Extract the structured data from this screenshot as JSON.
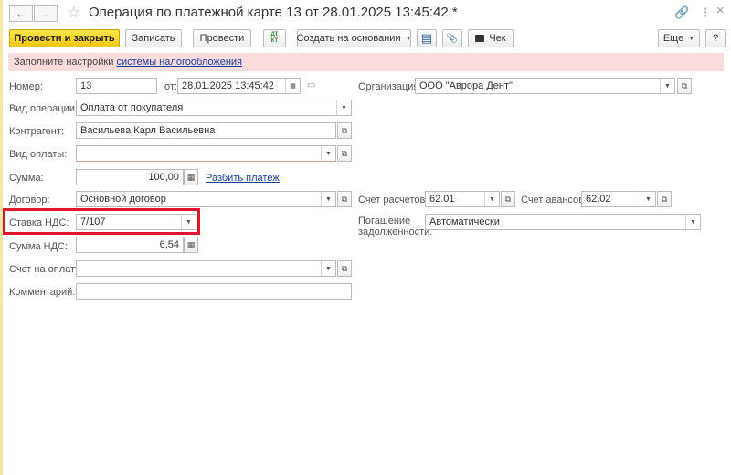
{
  "window": {
    "title": "Операция по платежной карте 13 от 28.01.2025 13:45:42 *",
    "back_icon": "←",
    "forward_icon": "→",
    "star_icon": "☆",
    "link_icon": "🔗",
    "more_icon": "⋮",
    "close_icon": "×"
  },
  "toolbar": {
    "post_and_close": "Провести и закрыть",
    "save": "Записать",
    "post": "Провести",
    "dt_kt_top": "ДТ",
    "dt_kt_bottom": "КТ",
    "create_based_on": "Создать на основании",
    "print_icon": "▤",
    "attach_icon": "📎",
    "receipt": "Чек",
    "more": "Еще",
    "help": "?"
  },
  "notice": {
    "prefix": "Заполните настройки ",
    "link": "системы налогообложения"
  },
  "form": {
    "number": {
      "label": "Номер:",
      "value": "13"
    },
    "date": {
      "label": "от:",
      "value": "28.01.2025 13:45:42"
    },
    "organization": {
      "label": "Организация:",
      "value": "ООО \"Аврора Дент\""
    },
    "operation_type": {
      "label": "Вид операции:",
      "value": "Оплата от покупателя"
    },
    "counterparty": {
      "label": "Контрагент:",
      "value": "Васильева Карл Васильевна"
    },
    "payment_type": {
      "label": "Вид оплаты:",
      "value": ""
    },
    "amount": {
      "label": "Сумма:",
      "value": "100,00",
      "split_link": "Разбить платеж"
    },
    "contract": {
      "label": "Договор:",
      "value": "Основной договор"
    },
    "settlement_account": {
      "label": "Счет расчетов:",
      "value": "62.01"
    },
    "advance_account": {
      "label": "Счет авансов:",
      "value": "62.02"
    },
    "vat_rate": {
      "label": "Ставка НДС:",
      "value": "7/107"
    },
    "debt_repayment": {
      "label_line1": "Погашение",
      "label_line2": "задолженности:",
      "value": "Автоматически"
    },
    "vat_amount": {
      "label": "Сумма НДС:",
      "value": "6,54"
    },
    "invoice": {
      "label": "Счет на оплату:",
      "value": ""
    },
    "comment": {
      "label": "Комментарий:",
      "value": ""
    }
  }
}
